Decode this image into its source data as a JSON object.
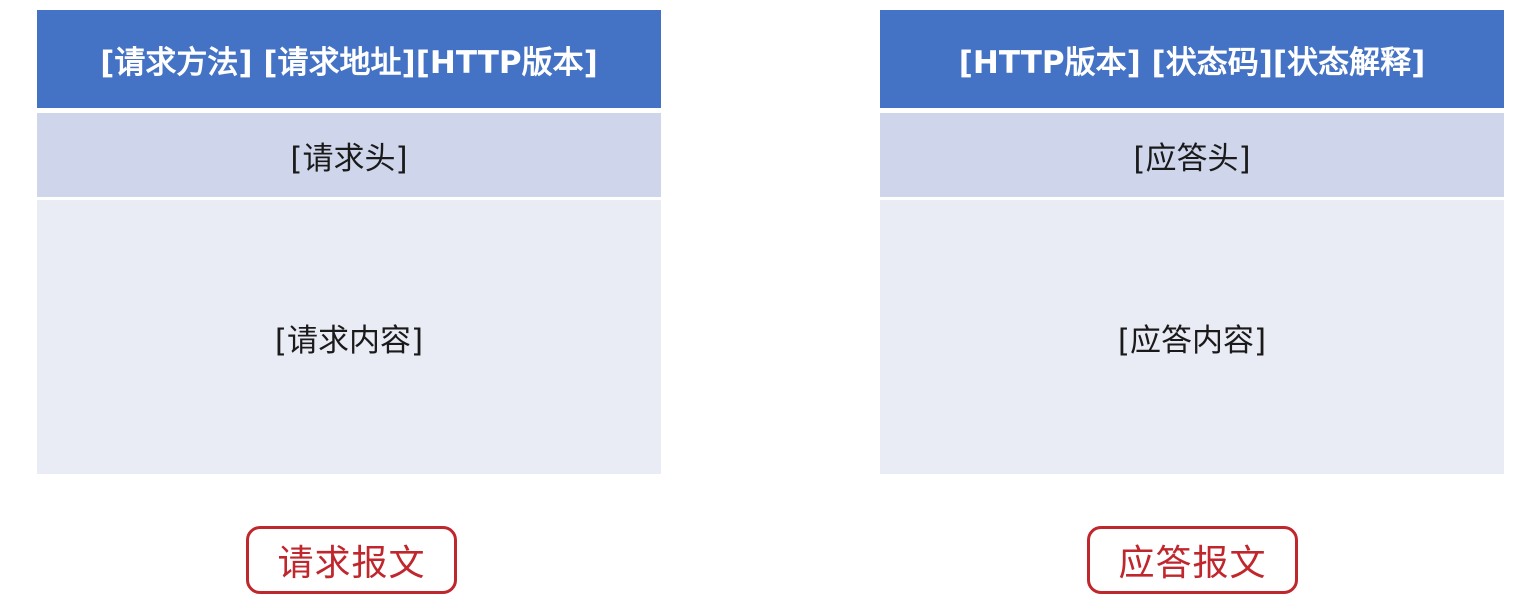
{
  "request": {
    "start_line": "[请求方法] [请求地址][HTTP版本]",
    "headers": "[请求头]",
    "body": "[请求内容]",
    "caption": "请求报文"
  },
  "response": {
    "status_line": "[HTTP版本] [状态码][状态解释]",
    "headers": "[应答头]",
    "body": "[应答内容]",
    "caption": "应答报文"
  },
  "colors": {
    "header_blue": "#4472c4",
    "headers_row": "#cfd5ea",
    "body_row": "#e9ebf5",
    "caption_red": "#c0272d"
  }
}
